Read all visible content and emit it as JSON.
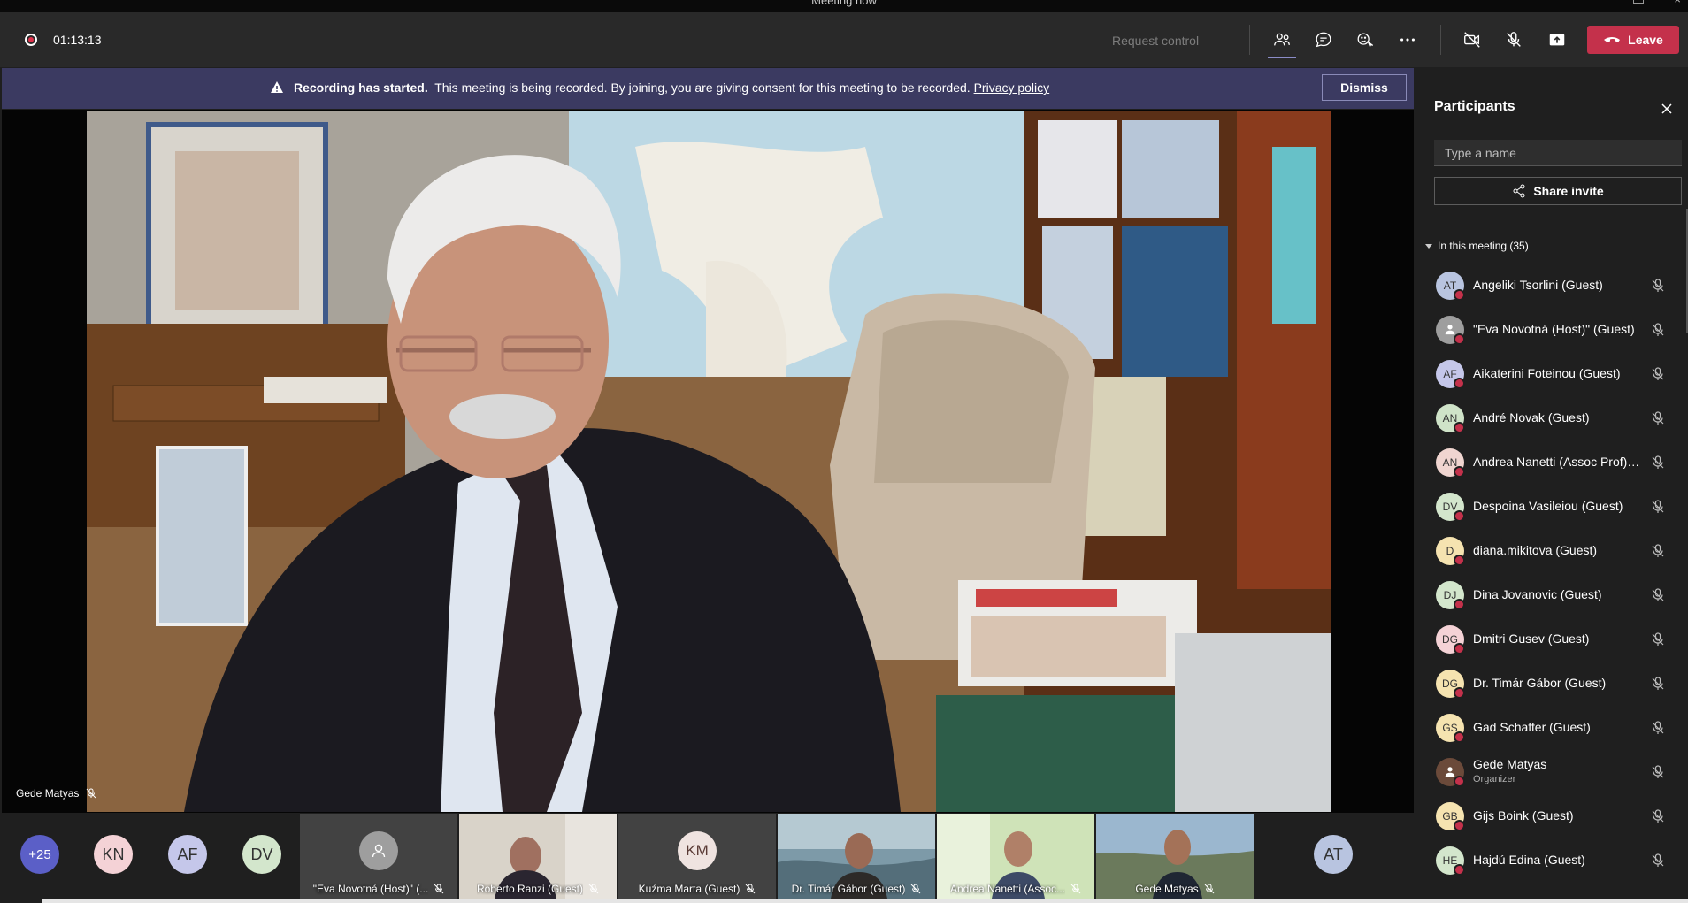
{
  "window": {
    "title": "Meeting now"
  },
  "toolbar": {
    "timer": "01:13:13",
    "request_control": "Request control",
    "leave_label": "Leave",
    "icons": [
      "people-icon",
      "chat-icon",
      "reactions-icon",
      "more-icon",
      "camera-off-icon",
      "mic-off-icon",
      "share-screen-icon"
    ]
  },
  "banner": {
    "bold_text": "Recording has started.",
    "text": "This meeting is being recorded. By joining, you are giving consent for this meeting to be recorded.",
    "link": "Privacy policy",
    "dismiss": "Dismiss"
  },
  "stage": {
    "speaker_name": "Gede Matyas"
  },
  "panel": {
    "title": "Participants",
    "search_placeholder": "Type a name",
    "share_invite": "Share invite",
    "section_label": "In this meeting (35)",
    "participants": [
      {
        "initials": "AT",
        "name": "Angeliki Tsorlini (Guest)",
        "color": "#b8c4e0"
      },
      {
        "initials": "",
        "name": "\"Eva Novotná (Host)\" (Guest)",
        "color": "#9e9e9e"
      },
      {
        "initials": "AF",
        "name": "Aikaterini Foteinou (Guest)",
        "color": "#c5c7ea"
      },
      {
        "initials": "AN",
        "name": "André Novak (Guest)",
        "color": "#cfe3c8"
      },
      {
        "initials": "AN",
        "name": "Andrea Nanetti (Assoc Prof) (...",
        "color": "#f0d5d0"
      },
      {
        "initials": "DV",
        "name": "Despoina Vasileiou (Guest)",
        "color": "#d3e6cc"
      },
      {
        "initials": "D",
        "name": "diana.mikitova (Guest)",
        "color": "#f5e3b0"
      },
      {
        "initials": "DJ",
        "name": "Dina Jovanovic (Guest)",
        "color": "#d3e6cc"
      },
      {
        "initials": "DG",
        "name": "Dmitri Gusev (Guest)",
        "color": "#f4d2d6"
      },
      {
        "initials": "DG",
        "name": "Dr. Timár Gábor (Guest)",
        "color": "#f5e3b0"
      },
      {
        "initials": "GS",
        "name": "Gad Schaffer (Guest)",
        "color": "#f5e3b0"
      },
      {
        "initials": "",
        "name": "Gede Matyas",
        "role": "Organizer",
        "color": "#6b4a3a"
      },
      {
        "initials": "GB",
        "name": "Gijs Boink (Guest)",
        "color": "#f5e3b0"
      },
      {
        "initials": "HE",
        "name": "Hajdú Edina (Guest)",
        "color": "#d3e6cc"
      }
    ]
  },
  "filmstrip": {
    "overflow": "+25",
    "circles": [
      {
        "initials": "KN",
        "color": "#f4d2d6"
      },
      {
        "initials": "AF",
        "color": "#c5c7ea"
      },
      {
        "initials": "DV",
        "color": "#d3e6cc"
      }
    ],
    "tiles": [
      {
        "label": "\"Eva Novotná (Host)\" (..."
      },
      {
        "label": "Roberto Ranzi (Guest)"
      },
      {
        "label": "Kuźma Marta (Guest)",
        "initials": "KM"
      },
      {
        "label": "Dr. Timár Gábor (Guest)"
      },
      {
        "label": "Andrea Nanetti (Assoc..."
      },
      {
        "label": "Gede Matyas"
      }
    ],
    "last_circle": {
      "initials": "AT",
      "color": "#b8c4e0"
    }
  }
}
